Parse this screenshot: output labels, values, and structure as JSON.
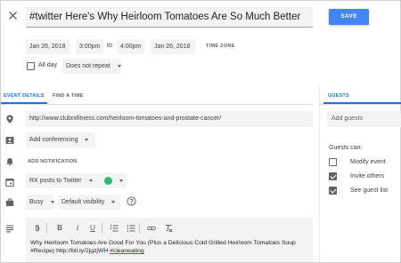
{
  "header": {
    "close_icon": "close-icon",
    "title": "#twitter Here's Why Heirloom Tomatoes Are So Much Better",
    "save_label": "SAVE",
    "save_color": "#4285f4"
  },
  "datetime": {
    "start_date": "Jan 26, 2018",
    "start_time": "3:00pm",
    "to_label": "to",
    "end_time": "4:00pm",
    "end_date": "Jan 26, 2018",
    "time_zone_label": "TIME ZONE",
    "all_day_label": "All day",
    "all_day_checked": false,
    "repeat_value": "Does not repeat"
  },
  "tabs": {
    "event_details": "EVENT DETAILS",
    "find_a_time": "FIND A TIME",
    "active_color": "#1a73e8"
  },
  "details": {
    "location_value": "http://www.clubrxfitness.com/heirloom-tomatoes-and-prostate-cancer/",
    "add_conferencing": "Add conferencing",
    "add_notification": "ADD NOTIFICATION",
    "calendar_value": "RX posts to Twitter",
    "calendar_color": "#33b679",
    "busy_value": "Busy",
    "visibility_value": "Default visibility",
    "help_icon": "help-icon",
    "description_text": "Why Heirloom Tomatoes Are Good For You (Plus a Delicious Cold Grilled Heirloom Tomatoes Soup #Recipe) http://bit.ly/2jgzjWH #cleaneating"
  },
  "toolbar": {
    "attach_icon": "attach-icon",
    "bold": "B",
    "italic": "I",
    "underline": "U",
    "numbered_list_icon": "numbered-list-icon",
    "bulleted_list_icon": "bulleted-list-icon",
    "link_icon": "link-icon",
    "clear_format_icon": "clear-format-icon"
  },
  "guests": {
    "tab_label": "GUESTS",
    "add_placeholder": "Add guests",
    "can_label": "Guests can:",
    "permissions": [
      {
        "label": "Modify event",
        "checked": false
      },
      {
        "label": "Invite others",
        "checked": true
      },
      {
        "label": "See guest list",
        "checked": true
      }
    ]
  }
}
